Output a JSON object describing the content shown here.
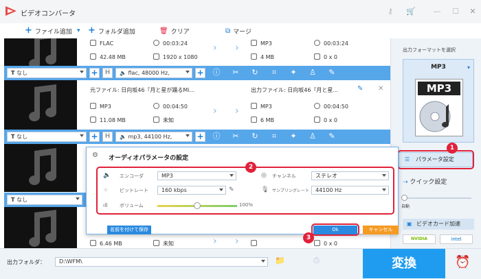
{
  "app": {
    "title": "ビデオコンバータ",
    "accent": "#1e7fd8",
    "bar_color": "#56a6ea",
    "highlight_color": "#e0213a"
  },
  "toolbar": {
    "add_file": "ファイル追加",
    "add_folder": "フォルダ追加",
    "clear": "クリア",
    "merge": "マージ"
  },
  "items": [
    {
      "src_format": "FLAC",
      "src_duration": "00:03:24",
      "src_size": "42.48 MB",
      "src_res": "1920 x 1080",
      "dst_format": "MP3",
      "dst_duration": "00:03:24",
      "dst_size": "4 MB",
      "dst_res": "0 x 0",
      "bar": {
        "subtitle": "なし",
        "audio": "flac, 48000 Hz, "
      }
    },
    {
      "src_name": "元ファイル: 日向坂46『月と星が踊るMi...",
      "dst_name": "出力ファイル: 日向坂46『月と星...",
      "src_format": "MP3",
      "src_duration": "00:04:50",
      "src_size": "11.08 MB",
      "src_res": "未知",
      "dst_format": "MP3",
      "dst_duration": "00:04:50",
      "dst_size": "6 MB",
      "dst_res": "0 x 0",
      "bar": {
        "subtitle": "なし",
        "audio": "mp3, 44100 Hz, "
      }
    },
    {
      "bar": {
        "subtitle": "なし"
      }
    },
    {
      "src_size": "6.46 MB",
      "src_res": "未知",
      "dst_size": "",
      "dst_res": "0 x 0"
    }
  ],
  "sidebar": {
    "format_title": "出力フォーマットを選択",
    "format": "MP3",
    "format_badge": "MP3",
    "param_button": "パラメータ設定",
    "quick_setting": "クイック設定",
    "auto": "自動",
    "gpu": "ビデオカード加速",
    "nvidia": "NVIDIA",
    "intel": "intel"
  },
  "dialog": {
    "title": "オーディオパラメータの設定",
    "encoder_label": "エンコーダ",
    "encoder": "MP3",
    "bitrate_label": "ビットレート",
    "bitrate": "160 kbps",
    "volume_label": "ボリューム",
    "volume_value": "100%",
    "volume_level": 0.5,
    "channel_label": "チャンネル",
    "channel": "ステレオ",
    "sample_label": "サンプリングレート",
    "sample": "44100 Hz",
    "save_as": "名前を付けて保存",
    "ok": "Ok",
    "cancel": "キャンセル"
  },
  "badges": {
    "one": "1",
    "two": "2",
    "three": "3"
  },
  "footer": {
    "output_folder_label": "出力フォルダ：",
    "output_folder": "D:\\WFM\\",
    "convert": "変換"
  }
}
